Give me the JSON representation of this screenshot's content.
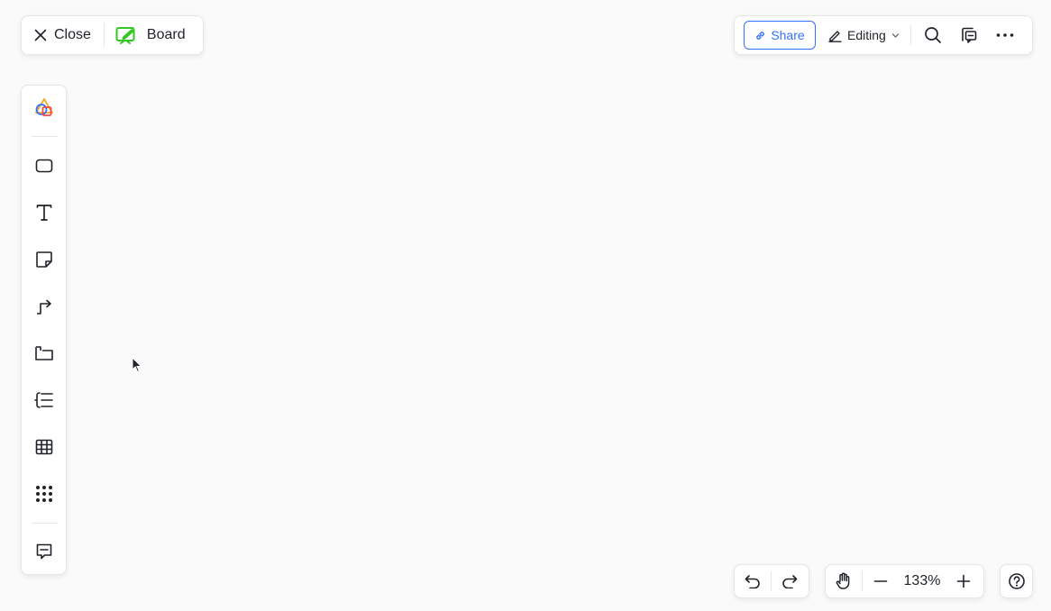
{
  "colors": {
    "accent": "#3370ff",
    "board_green": "#34c724",
    "text": "#1f2329",
    "icon": "#1f2329"
  },
  "header": {
    "close_label": "Close",
    "board_label": "Board",
    "share_label": "Share",
    "editing_label": "Editing"
  },
  "toolbar": {
    "items": [
      {
        "icon": "shapes-icon"
      },
      {
        "icon": "rectangle-icon"
      },
      {
        "icon": "text-icon"
      },
      {
        "icon": "sticky-note-icon"
      },
      {
        "icon": "connector-icon"
      },
      {
        "icon": "frame-icon"
      },
      {
        "icon": "mindmap-icon"
      },
      {
        "icon": "table-icon"
      },
      {
        "icon": "more-apps-icon"
      },
      {
        "icon": "comment-icon"
      }
    ]
  },
  "bottom": {
    "zoom_label": "133%"
  }
}
